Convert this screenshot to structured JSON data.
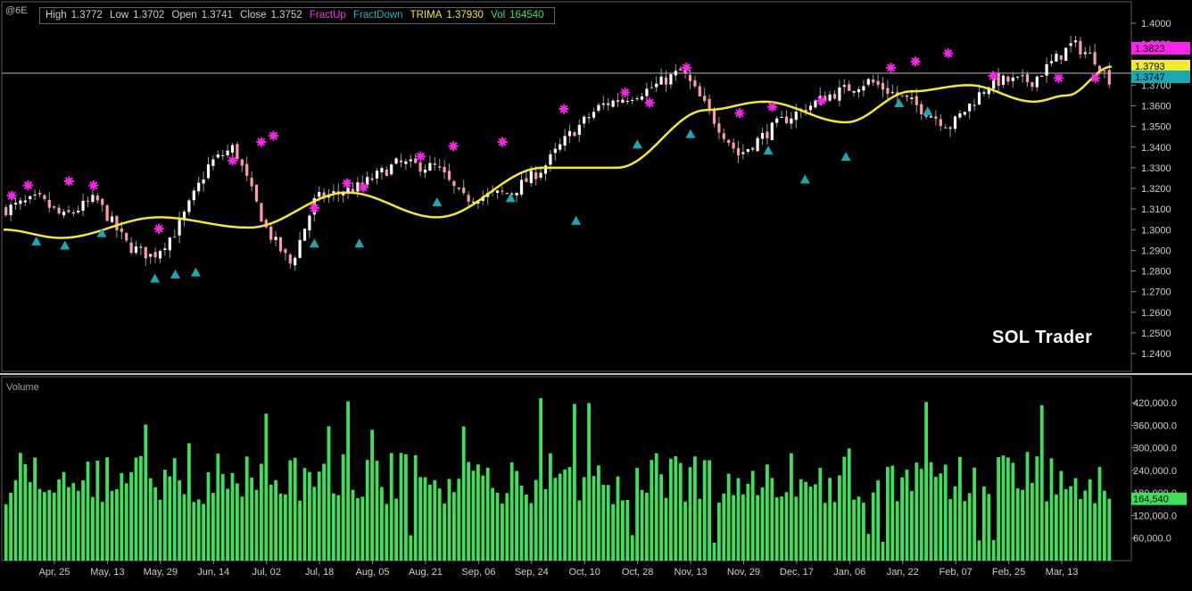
{
  "symbol": "@6E",
  "info": {
    "high_label": "High",
    "high": "1.3772",
    "low_label": "Low",
    "low": "1.3702",
    "open_label": "Open",
    "open": "1.3741",
    "close_label": "Close",
    "close": "1.3752",
    "fract_up": "FractUp",
    "fract_down": "FractDown",
    "trima_label": "TRIMA",
    "trima": "1.37930",
    "vol_label": "Vol",
    "vol": "164540"
  },
  "brand": "SOL Trader",
  "volume_panel_label": "Volume",
  "colors": {
    "background": "#000000",
    "candle_up": "#ffffff",
    "candle_down": "#ff9aa8",
    "trima": "#f2ea2a",
    "fractal_up": "#ff22ee",
    "fractal_down": "#1aa8b4",
    "volume": "#3ee05a",
    "grid": "#3a3a3a"
  },
  "price_tags": [
    {
      "value": "1.3823",
      "color": "#ff22ee"
    },
    {
      "value": "1.3793",
      "color": "#f2ea2a"
    },
    {
      "value": "1.3747",
      "color": "#1aa8b4"
    }
  ],
  "volume_tag": {
    "value": "164,540",
    "color": "#3ee05a"
  },
  "chart_data": [
    {
      "type": "candlestick",
      "title": "",
      "series_names": [
        "FractUp",
        "FractDown",
        "TRIMA"
      ],
      "x_tick_labels": [
        "Apr, 25",
        "May, 13",
        "May, 29",
        "Jun, 14",
        "Jul, 02",
        "Jul, 18",
        "Aug, 05",
        "Aug, 21",
        "Sep, 06",
        "Sep, 24",
        "Oct, 10",
        "Oct, 28",
        "Nov, 13",
        "Nov, 29",
        "Dec, 17",
        "Jan, 06",
        "Jan, 22",
        "Feb, 07",
        "Feb, 25",
        "Mar, 13"
      ],
      "y_ticks": [
        "1.4000",
        "1.3900",
        "1.3800",
        "1.3700",
        "1.3600",
        "1.3500",
        "1.3400",
        "1.3300",
        "1.3200",
        "1.3100",
        "1.3000",
        "1.2900",
        "1.2800",
        "1.2700",
        "1.2600",
        "1.2500",
        "1.2400"
      ],
      "ylim": [
        1.235,
        1.403
      ],
      "grid": false,
      "bar_count": 230,
      "close_anchors": [
        [
          0,
          1.31
        ],
        [
          8,
          1.315
        ],
        [
          14,
          1.306
        ],
        [
          22,
          1.315
        ],
        [
          30,
          1.292
        ],
        [
          36,
          1.287
        ],
        [
          42,
          1.3
        ],
        [
          50,
          1.332
        ],
        [
          56,
          1.34
        ],
        [
          64,
          1.3
        ],
        [
          70,
          1.283
        ],
        [
          76,
          1.315
        ],
        [
          86,
          1.32
        ],
        [
          96,
          1.332
        ],
        [
          106,
          1.33
        ],
        [
          112,
          1.315
        ],
        [
          124,
          1.318
        ],
        [
          132,
          1.33
        ],
        [
          138,
          1.345
        ],
        [
          146,
          1.36
        ],
        [
          158,
          1.368
        ],
        [
          166,
          1.377
        ],
        [
          174,
          1.353
        ],
        [
          180,
          1.336
        ],
        [
          190,
          1.352
        ],
        [
          202,
          1.365
        ],
        [
          212,
          1.372
        ],
        [
          222,
          1.362
        ],
        [
          232,
          1.35
        ],
        [
          242,
          1.372
        ],
        [
          252,
          1.372
        ],
        [
          262,
          1.39
        ],
        [
          268,
          1.382
        ],
        [
          270,
          1.375
        ],
        [
          271,
          1.373
        ]
      ],
      "fractal_up_points": [
        [
          2,
          1.313
        ],
        [
          6,
          1.318
        ],
        [
          16,
          1.32
        ],
        [
          22,
          1.318
        ],
        [
          38,
          1.297
        ],
        [
          56,
          1.33
        ],
        [
          63,
          1.339
        ],
        [
          66,
          1.342
        ],
        [
          76,
          1.307
        ],
        [
          84,
          1.319
        ],
        [
          88,
          1.317
        ],
        [
          102,
          1.332
        ],
        [
          110,
          1.337
        ],
        [
          122,
          1.339
        ],
        [
          137,
          1.355
        ],
        [
          152,
          1.363
        ],
        [
          158,
          1.358
        ],
        [
          167,
          1.375
        ],
        [
          180,
          1.353
        ],
        [
          188,
          1.356
        ],
        [
          200,
          1.359
        ],
        [
          217,
          1.375
        ],
        [
          223,
          1.378
        ],
        [
          231,
          1.382
        ],
        [
          242,
          1.371
        ],
        [
          267,
          1.37
        ],
        [
          280,
          1.372
        ],
        [
          258,
          1.37
        ]
      ],
      "fractal_down_points": [
        [
          8,
          1.298
        ],
        [
          15,
          1.296
        ],
        [
          24,
          1.302
        ],
        [
          37,
          1.28
        ],
        [
          42,
          1.282
        ],
        [
          47,
          1.283
        ],
        [
          76,
          1.297
        ],
        [
          87,
          1.297
        ],
        [
          106,
          1.317
        ],
        [
          124,
          1.319
        ],
        [
          140,
          1.308
        ],
        [
          155,
          1.345
        ],
        [
          168,
          1.35
        ],
        [
          187,
          1.342
        ],
        [
          196,
          1.328
        ],
        [
          206,
          1.339
        ],
        [
          219,
          1.365
        ],
        [
          226,
          1.361
        ]
      ],
      "trima_path": "fitted smooth yellow line passing 1.300 → 1.306 → 1.300 → 1.315 → 1.307 → 1.330 → 1.332 → 1.360 → 1.350 → 1.369 → 1.362 → 1.378",
      "trima_last": 1.3793
    },
    {
      "type": "bar",
      "title": "Volume",
      "y_ticks": [
        "420,000.0",
        "360,000.0",
        "300,000.0",
        "240,000.0",
        "180,000.0",
        "120,000.0",
        "60,000.0"
      ],
      "ylim": [
        0,
        470000
      ],
      "last_value": 164540,
      "sample_values": [
        230000,
        245000,
        270000,
        300000,
        345000,
        250000,
        210000,
        220000,
        270000,
        190000,
        230000,
        260000,
        230000,
        420000,
        290000,
        140000,
        250000,
        240000,
        290000,
        170000
      ]
    }
  ]
}
